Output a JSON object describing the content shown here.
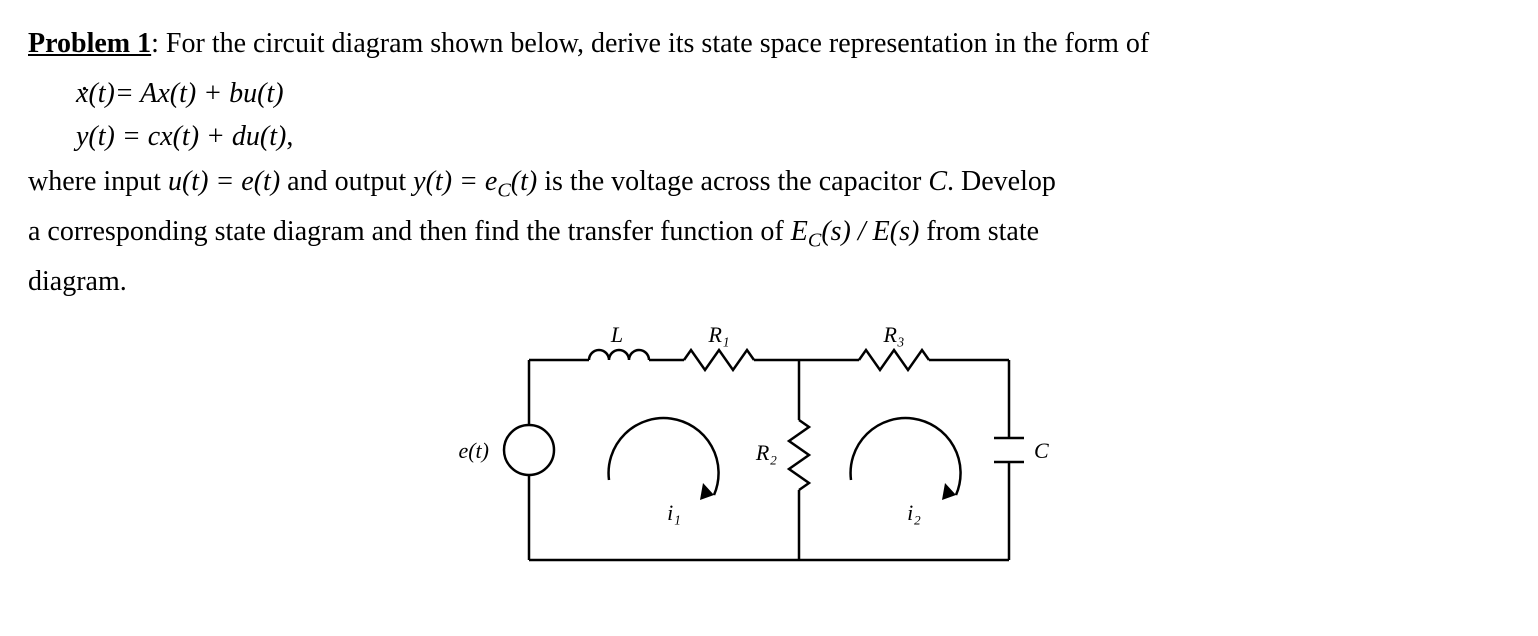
{
  "problem": {
    "label": "Problem 1",
    "intro_after_label": ": For the circuit diagram shown below, derive its state space representation in the form of",
    "eq1_lhs_var": "x",
    "eq1_lhs_arg": "(t)",
    "eq1_rhs": " = Ax(t) + bu(t)",
    "eq2": "y(t) = cx(t) + du(t)",
    "eq_trailer": " ,",
    "body1_a": "where input  ",
    "body1_b": "u(t) = e(t)",
    "body1_c": "  and output  ",
    "body1_d": "y(t) = e",
    "body1_d_sub": "C",
    "body1_e": "(t)",
    "body1_f": "  is the voltage across the capacitor ",
    "body1_g": "C",
    "body1_h": ". Develop",
    "body2_a": "a corresponding state diagram and then find the transfer function of  ",
    "body2_b": "E",
    "body2_b_sub": "C",
    "body2_c": "(s) / E(s)",
    "body2_d": "  from state",
    "body3": "diagram."
  },
  "circuit": {
    "source_label": "e(t)",
    "L_label": "L",
    "R1_label": "R₁",
    "R2_label": "R₂",
    "R3_label": "R₃",
    "C_label": "C",
    "i1_label": "i₁",
    "i2_label": "i₂"
  }
}
